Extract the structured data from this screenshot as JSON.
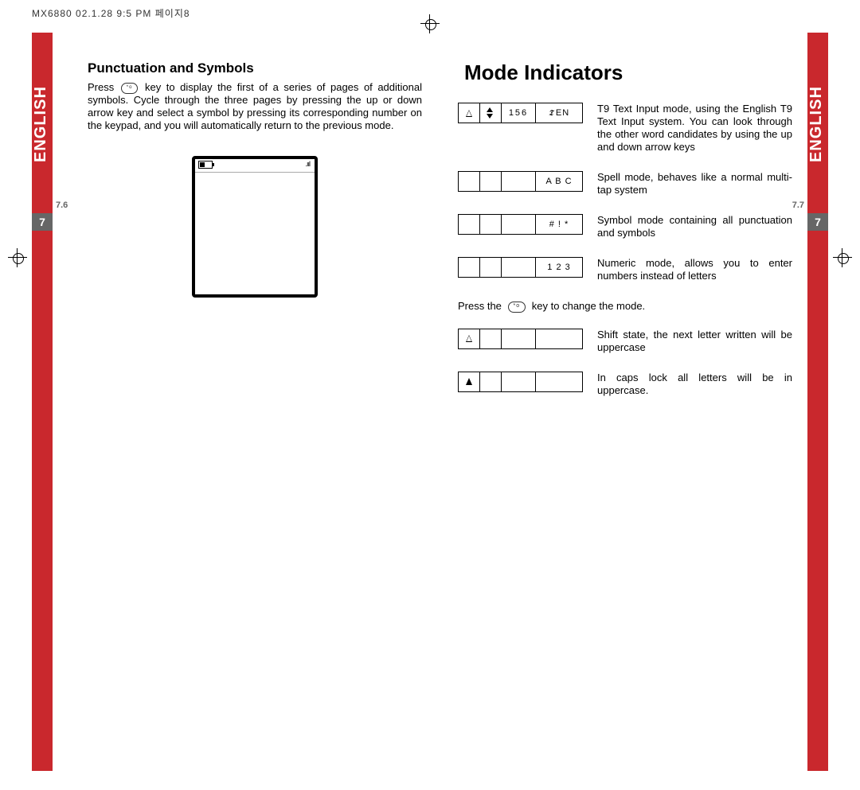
{
  "header": "MX6880 02.1.28 9:5  PM     페이지8",
  "left": {
    "lang": "ENGLISH",
    "chapter": "7",
    "sub": "7.6",
    "heading": "Punctuation and Symbols",
    "body_a": "Press",
    "body_b": "key to display the first of a series of pages of additional symbols. Cycle through the three pages by pressing the up or down arrow key and select a symbol by pressing its corresponding number on the keypad, and you will automatically return to the previous mode."
  },
  "right": {
    "lang": "ENGLISH",
    "chapter": "7",
    "sub": "7.7",
    "title": "Mode Indicators",
    "modes": [
      {
        "count": "156",
        "label": "EN",
        "desc": "T9 Text Input mode, using the English T9 Text Input system. You can look through the other word candidates by using the up and down arrow keys"
      },
      {
        "label": "A B C",
        "desc": "Spell mode, behaves like a normal multi-tap system"
      },
      {
        "label": "# ! *",
        "desc": "Symbol mode containing all punctuation and symbols"
      },
      {
        "label": "1 2 3",
        "desc": "Numeric mode, allows you to enter numbers instead of letters"
      }
    ],
    "change_a": "Press the",
    "change_b": "key to change the mode.",
    "shift": [
      {
        "desc": "Shift state, the next letter written will be uppercase"
      },
      {
        "desc": "In caps lock all letters will be in uppercase."
      }
    ]
  }
}
